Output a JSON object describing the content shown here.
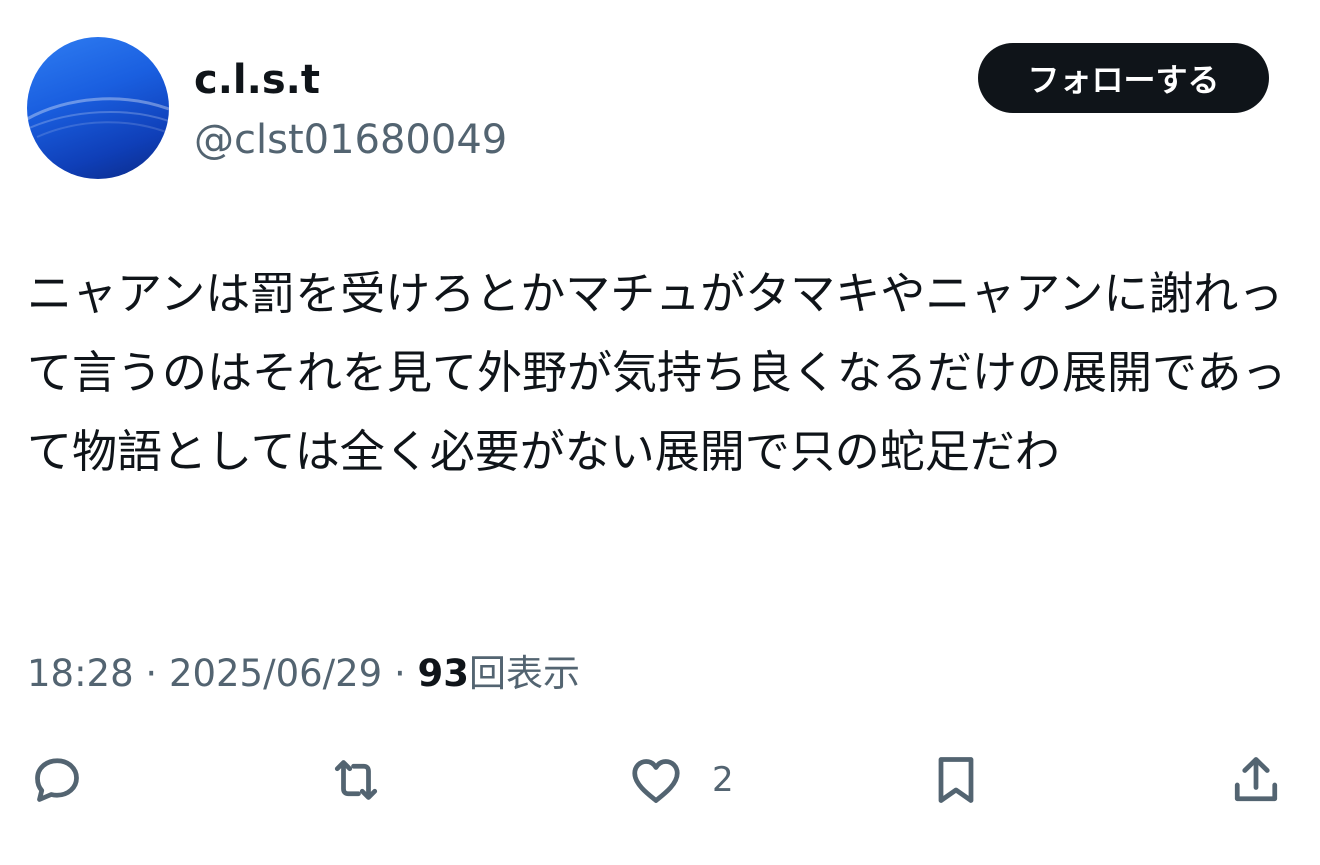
{
  "author": {
    "display_name": "c.l.s.t",
    "handle": "@clst01680049"
  },
  "follow_button": {
    "label": "フォローする"
  },
  "tweet": {
    "text": "ニャアンは罰を受けろとかマチュがタマキやニャアンに謝れって言うのはそれを見て外野が気持ち良くなるだけの展開であって物語としては全く必要がない展開で只の蛇足だわ"
  },
  "meta": {
    "time": "18:28",
    "separator": "·",
    "date": "2025/06/29",
    "views_count": "93",
    "views_label": "回表示"
  },
  "actions": {
    "like_count": "2"
  },
  "colors": {
    "text_primary": "#0f1419",
    "text_secondary": "#536471",
    "button_bg": "#0f1419",
    "avatar_blue": "#1a5fe0"
  }
}
